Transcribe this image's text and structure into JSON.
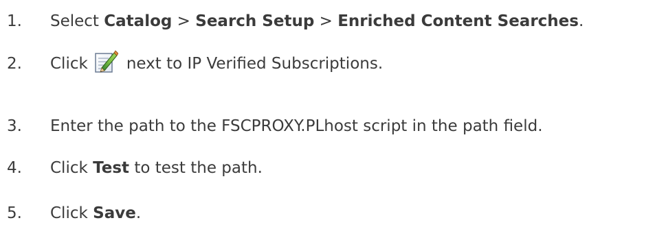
{
  "steps": [
    {
      "number": "1.",
      "parts": {
        "prefix": "Select",
        "b1": "Catalog",
        "sep1": ">",
        "b2": "Search Setup",
        "sep2": ">",
        "b3": "Enriched Content Searches",
        "suffix": "."
      }
    },
    {
      "number": "2.",
      "parts": {
        "prefix": "Click",
        "icon": "edit-icon",
        "suffix": "next to IP Verified Subscriptions."
      }
    },
    {
      "number": "3.",
      "parts": {
        "text": "Enter the path to the FSCPROXY.PLhost script in the path field."
      }
    },
    {
      "number": "4.",
      "parts": {
        "prefix": "Click",
        "b1": "Test",
        "suffix": "to test the path."
      }
    },
    {
      "number": "5.",
      "parts": {
        "prefix": "Click",
        "b1": "Save",
        "suffix": "."
      }
    }
  ]
}
